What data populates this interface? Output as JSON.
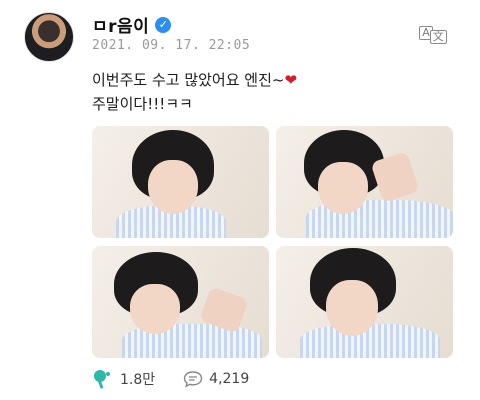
{
  "author": {
    "name": "ㅁr음이",
    "verified": true
  },
  "timestamp": "2021. 09. 17. 22:05",
  "post": {
    "line1": "이번주도 수고 많았어요 엔진~",
    "line2": "주말이다!!!ㅋㅋ"
  },
  "icons": {
    "translate": "translate-icon",
    "heart": "heart-emoji",
    "cheer": "cheer-icon",
    "comment": "comment-icon"
  },
  "photos": [
    "photo-1",
    "photo-2",
    "photo-3",
    "photo-4"
  ],
  "actions": {
    "cheers": "1.8만",
    "comments": "4,219"
  },
  "colors": {
    "accent": "#2d8ef0",
    "heart": "#d11f2c",
    "cheer": "#2fb7a8"
  }
}
